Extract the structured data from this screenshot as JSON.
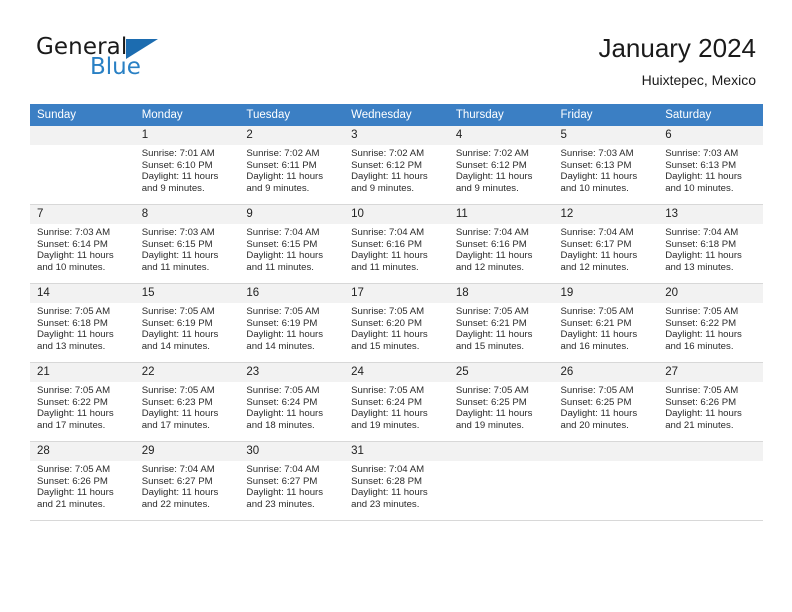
{
  "brand": {
    "word1": "General",
    "word2": "Blue",
    "triangle_color": "#1c6cb0",
    "blue_color": "#2980c4"
  },
  "header": {
    "title": "January 2024",
    "subtitle": "Huixtepec, Mexico"
  },
  "theme": {
    "header_row_bg": "#3b7fc4",
    "daynum_bg": "#f2f2f2",
    "row_border": "#d8d8d8"
  },
  "weekdays": [
    "Sunday",
    "Monday",
    "Tuesday",
    "Wednesday",
    "Thursday",
    "Friday",
    "Saturday"
  ],
  "weeks": [
    [
      {
        "day": "",
        "sunrise": "",
        "sunset": "",
        "daylight": "",
        "empty": true
      },
      {
        "day": "1",
        "sunrise": "Sunrise: 7:01 AM",
        "sunset": "Sunset: 6:10 PM",
        "daylight": "Daylight: 11 hours and 9 minutes."
      },
      {
        "day": "2",
        "sunrise": "Sunrise: 7:02 AM",
        "sunset": "Sunset: 6:11 PM",
        "daylight": "Daylight: 11 hours and 9 minutes."
      },
      {
        "day": "3",
        "sunrise": "Sunrise: 7:02 AM",
        "sunset": "Sunset: 6:12 PM",
        "daylight": "Daylight: 11 hours and 9 minutes."
      },
      {
        "day": "4",
        "sunrise": "Sunrise: 7:02 AM",
        "sunset": "Sunset: 6:12 PM",
        "daylight": "Daylight: 11 hours and 9 minutes."
      },
      {
        "day": "5",
        "sunrise": "Sunrise: 7:03 AM",
        "sunset": "Sunset: 6:13 PM",
        "daylight": "Daylight: 11 hours and 10 minutes."
      },
      {
        "day": "6",
        "sunrise": "Sunrise: 7:03 AM",
        "sunset": "Sunset: 6:13 PM",
        "daylight": "Daylight: 11 hours and 10 minutes."
      }
    ],
    [
      {
        "day": "7",
        "sunrise": "Sunrise: 7:03 AM",
        "sunset": "Sunset: 6:14 PM",
        "daylight": "Daylight: 11 hours and 10 minutes."
      },
      {
        "day": "8",
        "sunrise": "Sunrise: 7:03 AM",
        "sunset": "Sunset: 6:15 PM",
        "daylight": "Daylight: 11 hours and 11 minutes."
      },
      {
        "day": "9",
        "sunrise": "Sunrise: 7:04 AM",
        "sunset": "Sunset: 6:15 PM",
        "daylight": "Daylight: 11 hours and 11 minutes."
      },
      {
        "day": "10",
        "sunrise": "Sunrise: 7:04 AM",
        "sunset": "Sunset: 6:16 PM",
        "daylight": "Daylight: 11 hours and 11 minutes."
      },
      {
        "day": "11",
        "sunrise": "Sunrise: 7:04 AM",
        "sunset": "Sunset: 6:16 PM",
        "daylight": "Daylight: 11 hours and 12 minutes."
      },
      {
        "day": "12",
        "sunrise": "Sunrise: 7:04 AM",
        "sunset": "Sunset: 6:17 PM",
        "daylight": "Daylight: 11 hours and 12 minutes."
      },
      {
        "day": "13",
        "sunrise": "Sunrise: 7:04 AM",
        "sunset": "Sunset: 6:18 PM",
        "daylight": "Daylight: 11 hours and 13 minutes."
      }
    ],
    [
      {
        "day": "14",
        "sunrise": "Sunrise: 7:05 AM",
        "sunset": "Sunset: 6:18 PM",
        "daylight": "Daylight: 11 hours and 13 minutes."
      },
      {
        "day": "15",
        "sunrise": "Sunrise: 7:05 AM",
        "sunset": "Sunset: 6:19 PM",
        "daylight": "Daylight: 11 hours and 14 minutes."
      },
      {
        "day": "16",
        "sunrise": "Sunrise: 7:05 AM",
        "sunset": "Sunset: 6:19 PM",
        "daylight": "Daylight: 11 hours and 14 minutes."
      },
      {
        "day": "17",
        "sunrise": "Sunrise: 7:05 AM",
        "sunset": "Sunset: 6:20 PM",
        "daylight": "Daylight: 11 hours and 15 minutes."
      },
      {
        "day": "18",
        "sunrise": "Sunrise: 7:05 AM",
        "sunset": "Sunset: 6:21 PM",
        "daylight": "Daylight: 11 hours and 15 minutes."
      },
      {
        "day": "19",
        "sunrise": "Sunrise: 7:05 AM",
        "sunset": "Sunset: 6:21 PM",
        "daylight": "Daylight: 11 hours and 16 minutes."
      },
      {
        "day": "20",
        "sunrise": "Sunrise: 7:05 AM",
        "sunset": "Sunset: 6:22 PM",
        "daylight": "Daylight: 11 hours and 16 minutes."
      }
    ],
    [
      {
        "day": "21",
        "sunrise": "Sunrise: 7:05 AM",
        "sunset": "Sunset: 6:22 PM",
        "daylight": "Daylight: 11 hours and 17 minutes."
      },
      {
        "day": "22",
        "sunrise": "Sunrise: 7:05 AM",
        "sunset": "Sunset: 6:23 PM",
        "daylight": "Daylight: 11 hours and 17 minutes."
      },
      {
        "day": "23",
        "sunrise": "Sunrise: 7:05 AM",
        "sunset": "Sunset: 6:24 PM",
        "daylight": "Daylight: 11 hours and 18 minutes."
      },
      {
        "day": "24",
        "sunrise": "Sunrise: 7:05 AM",
        "sunset": "Sunset: 6:24 PM",
        "daylight": "Daylight: 11 hours and 19 minutes."
      },
      {
        "day": "25",
        "sunrise": "Sunrise: 7:05 AM",
        "sunset": "Sunset: 6:25 PM",
        "daylight": "Daylight: 11 hours and 19 minutes."
      },
      {
        "day": "26",
        "sunrise": "Sunrise: 7:05 AM",
        "sunset": "Sunset: 6:25 PM",
        "daylight": "Daylight: 11 hours and 20 minutes."
      },
      {
        "day": "27",
        "sunrise": "Sunrise: 7:05 AM",
        "sunset": "Sunset: 6:26 PM",
        "daylight": "Daylight: 11 hours and 21 minutes."
      }
    ],
    [
      {
        "day": "28",
        "sunrise": "Sunrise: 7:05 AM",
        "sunset": "Sunset: 6:26 PM",
        "daylight": "Daylight: 11 hours and 21 minutes."
      },
      {
        "day": "29",
        "sunrise": "Sunrise: 7:04 AM",
        "sunset": "Sunset: 6:27 PM",
        "daylight": "Daylight: 11 hours and 22 minutes."
      },
      {
        "day": "30",
        "sunrise": "Sunrise: 7:04 AM",
        "sunset": "Sunset: 6:27 PM",
        "daylight": "Daylight: 11 hours and 23 minutes."
      },
      {
        "day": "31",
        "sunrise": "Sunrise: 7:04 AM",
        "sunset": "Sunset: 6:28 PM",
        "daylight": "Daylight: 11 hours and 23 minutes."
      },
      {
        "day": "",
        "sunrise": "",
        "sunset": "",
        "daylight": "",
        "empty": true
      },
      {
        "day": "",
        "sunrise": "",
        "sunset": "",
        "daylight": "",
        "empty": true
      },
      {
        "day": "",
        "sunrise": "",
        "sunset": "",
        "daylight": "",
        "empty": true
      }
    ]
  ]
}
